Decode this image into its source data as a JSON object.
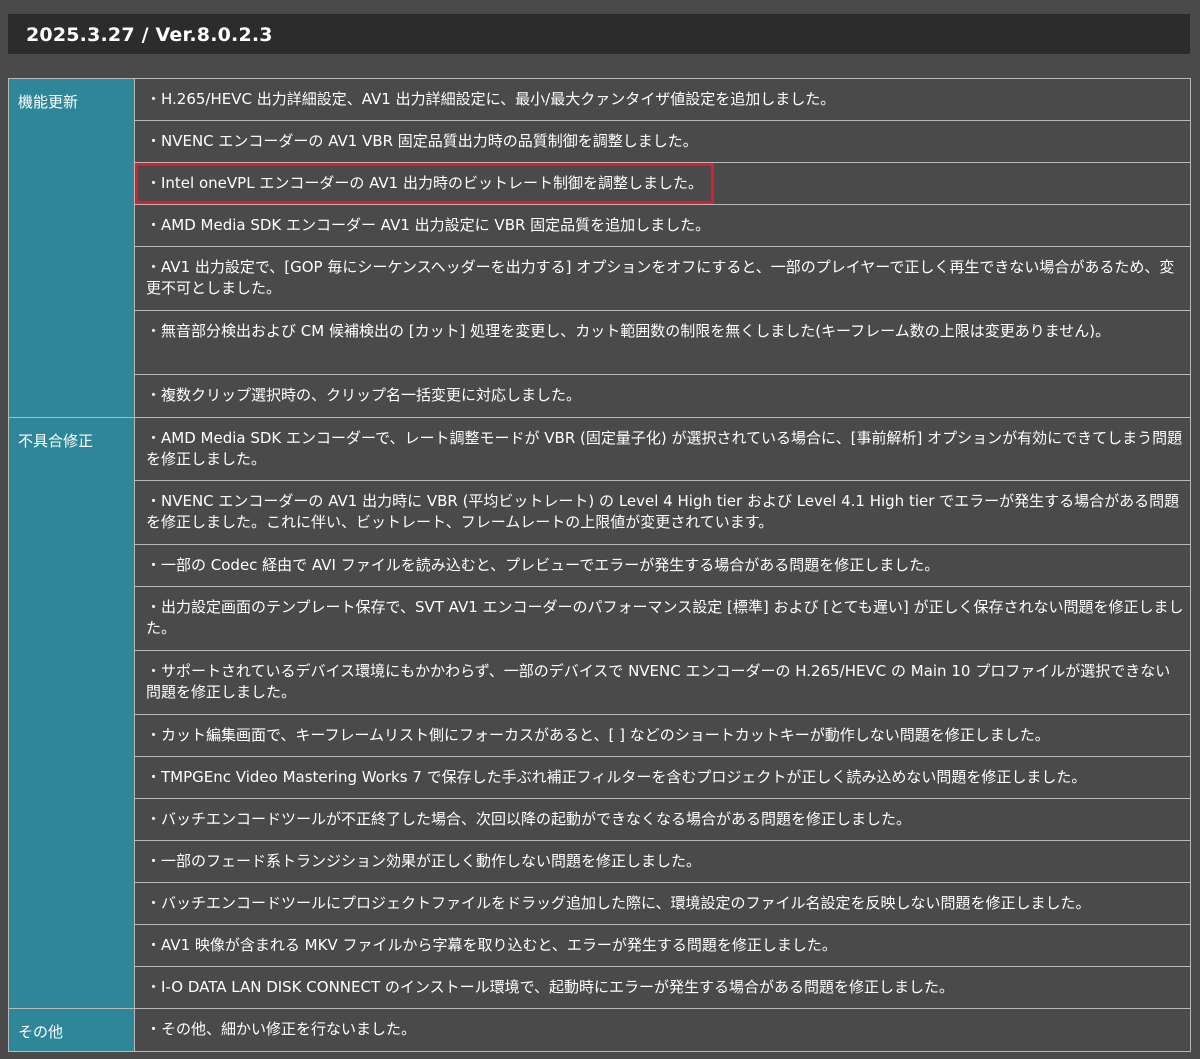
{
  "header": {
    "title": "2025.3.27 / Ver.8.0.2.3"
  },
  "colors": {
    "background": "#4a4a4a",
    "header_bar": "#2c2c2c",
    "category_cell": "#2d8798",
    "border": "#b8b8b8",
    "highlight": "#d9202a"
  },
  "sections": [
    {
      "category": "機能更新",
      "items": [
        "・H.265/HEVC 出力詳細設定、AV1 出力詳細設定に、最小/最大クァンタイザ値設定を追加しました。",
        "・NVENC エンコーダーの AV1 VBR 固定品質出力時の品質制御を調整しました。",
        "・Intel oneVPL エンコーダーの AV1 出力時のビットレート制御を調整しました。",
        "・AMD Media SDK エンコーダー AV1 出力設定に VBR 固定品質を追加しました。",
        "・AV1 出力設定で、[GOP 毎にシーケンスヘッダーを出力する] オプションをオフにすると、一部のプレイヤーで正しく再生できない場合があるため、変更不可としました。",
        "・無音部分検出および CM 候補検出の [カット] 処理を変更し、カット範囲数の制限を無くしました(キーフレーム数の上限は変更ありません)。",
        "・複数クリップ選択時の、クリップ名一括変更に対応しました。"
      ]
    },
    {
      "category": "不具合修正",
      "items": [
        "・AMD Media SDK エンコーダーで、レート調整モードが VBR (固定量子化) が選択されている場合に、[事前解析] オプションが有効にできてしまう問題を修正しました。",
        "・NVENC エンコーダーの AV1 出力時に VBR (平均ビットレート) の Level 4 High tier および Level 4.1 High tier でエラーが発生する場合がある問題を修正しました。これに伴い、ビットレート、フレームレートの上限値が変更されています。",
        "・一部の Codec 経由で AVI ファイルを読み込むと、プレビューでエラーが発生する場合がある問題を修正しました。",
        "・出力設定画面のテンプレート保存で、SVT AV1 エンコーダーのパフォーマンス設定 [標準] および [とても遅い] が正しく保存されない問題を修正しました。",
        "・サポートされているデバイス環境にもかかわらず、一部のデバイスで NVENC エンコーダーの H.265/HEVC の Main 10 プロファイルが選択できない問題を修正しました。",
        "・カット編集画面で、キーフレームリスト側にフォーカスがあると、[ ] などのショートカットキーが動作しない問題を修正しました。",
        "・TMPGEnc Video Mastering Works 7 で保存した手ぶれ補正フィルターを含むプロジェクトが正しく読み込めない問題を修正しました。",
        "・バッチエンコードツールが不正終了した場合、次回以降の起動ができなくなる場合がある問題を修正しました。",
        "・一部のフェード系トランジション効果が正しく動作しない問題を修正しました。",
        "・バッチエンコードツールにプロジェクトファイルをドラッグ追加した際に、環境設定のファイル名設定を反映しない問題を修正しました。",
        "・AV1 映像が含まれる MKV ファイルから字幕を取り込むと、エラーが発生する問題を修正しました。",
        "・I-O DATA LAN DISK CONNECT のインストール環境で、起動時にエラーが発生する場合がある問題を修正しました。"
      ]
    },
    {
      "category": "その他",
      "items": [
        "・その他、細かい修正を行ないました。"
      ]
    }
  ]
}
